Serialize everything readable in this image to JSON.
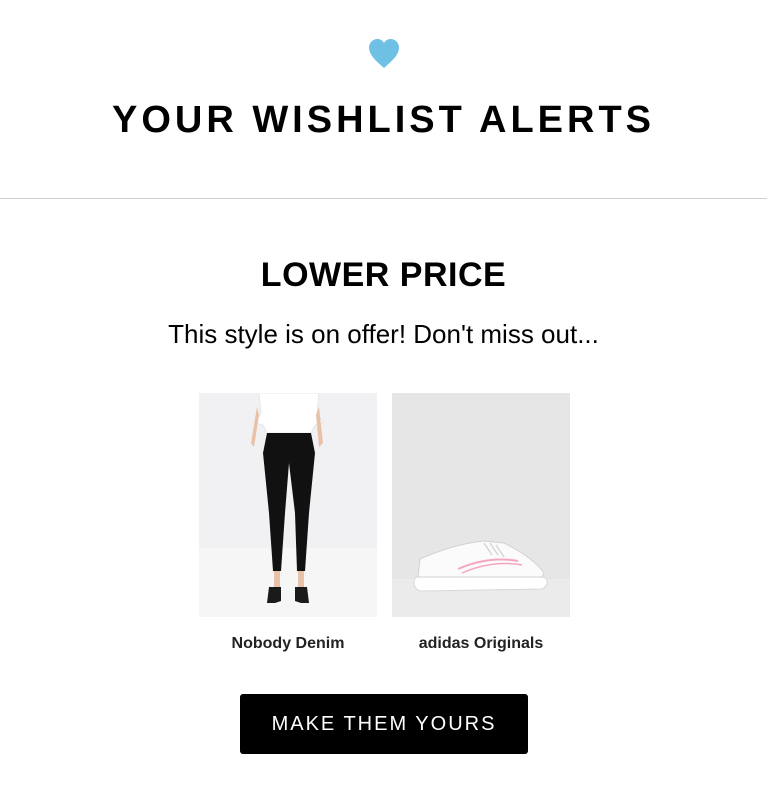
{
  "header": {
    "icon": "heart-icon",
    "icon_color": "#6EC1E4",
    "title": "YOUR WISHLIST ALERTS"
  },
  "alert": {
    "heading": "LOWER PRICE",
    "message": "This style is on offer! Don't miss out..."
  },
  "products": [
    {
      "brand": "Nobody Denim",
      "image": "model-wearing-black-skinny-jeans-and-white-tee"
    },
    {
      "brand": "adidas Originals",
      "image": "white-sneaker-with-pink-stripe"
    }
  ],
  "cta": {
    "label": "MAKE THEM YOURS",
    "background": "#000000",
    "text_color": "#ffffff"
  }
}
